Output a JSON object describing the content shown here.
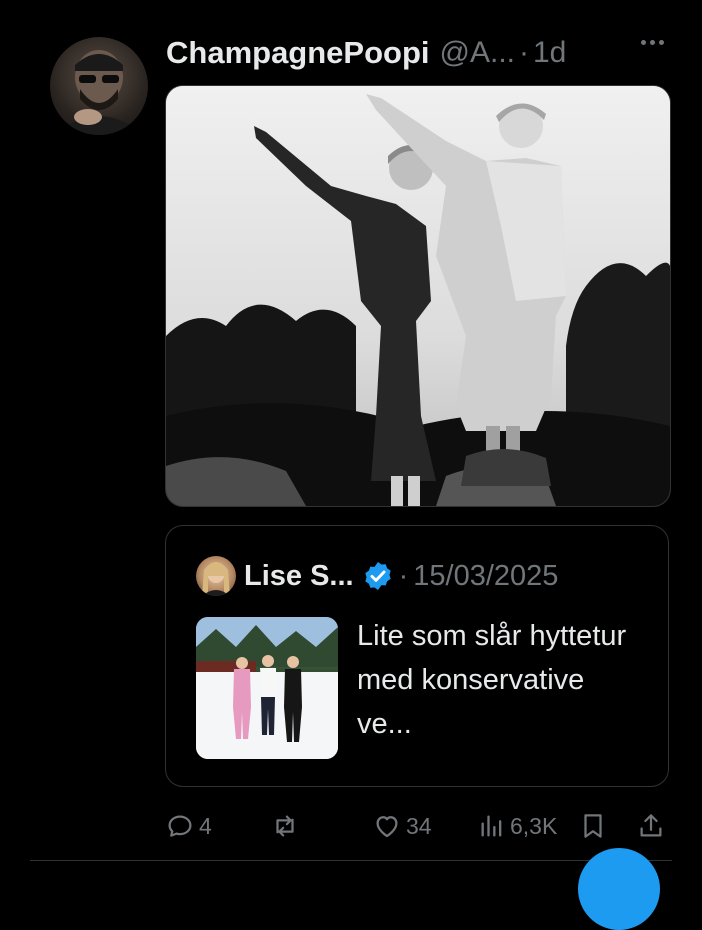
{
  "tweet": {
    "display_name": "ChampagnePoopi",
    "handle": "@A...",
    "separator": "·",
    "time": "1d",
    "more_icon": "more-horizontal-icon"
  },
  "quote": {
    "name": "Lise S...",
    "separator": "·",
    "date": "15/03/2025",
    "text": "Lite som slår hyttetur med konservative ve...",
    "verified_icon": "verified-badge-icon"
  },
  "actions": {
    "replies": "4",
    "reposts": "",
    "likes": "34",
    "views": "6,3K"
  },
  "colors": {
    "background": "#000000",
    "text_primary": "#e7e9ea",
    "text_secondary": "#71767b",
    "accent": "#1d9bf0",
    "border": "#2f3336"
  }
}
